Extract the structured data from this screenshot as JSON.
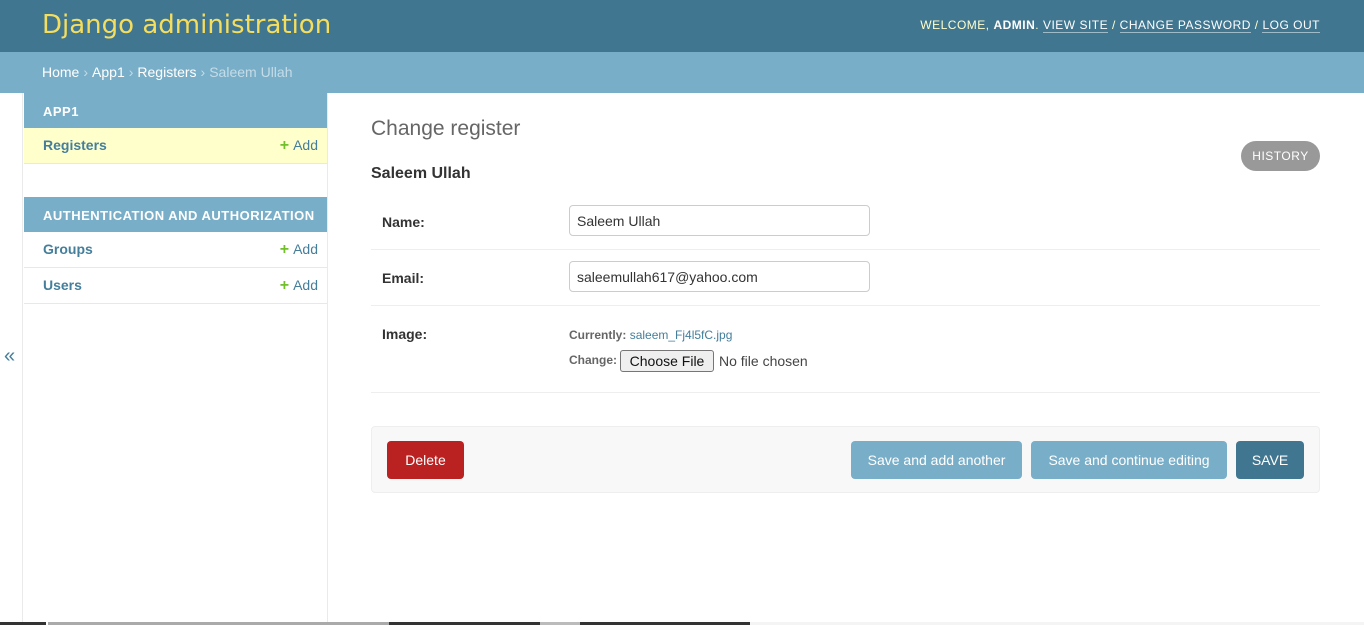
{
  "header": {
    "brand": "Django administration",
    "welcome_prefix": "WELCOME, ",
    "username": "ADMIN",
    "welcome_suffix": ". ",
    "view_site": "VIEW SITE",
    "change_password": "CHANGE PASSWORD",
    "log_out": "LOG OUT",
    "separator": " / "
  },
  "breadcrumbs": {
    "items": [
      "Home",
      "App1",
      "Registers"
    ],
    "current": "Saleem Ullah",
    "separator": "›"
  },
  "nav_toggle": "«",
  "sidebar": {
    "modules": [
      {
        "caption": "APP1",
        "rows": [
          {
            "label": "Registers",
            "add": "Add",
            "current": true
          }
        ]
      },
      {
        "caption": "AUTHENTICATION AND AUTHORIZATION",
        "rows": [
          {
            "label": "Groups",
            "add": "Add"
          },
          {
            "label": "Users",
            "add": "Add"
          }
        ]
      }
    ],
    "add_icon": "+"
  },
  "content": {
    "title": "Change register",
    "object_name": "Saleem Ullah",
    "history": "HISTORY",
    "fields": {
      "name_label": "Name:",
      "name_value": "Saleem Ullah",
      "email_label": "Email:",
      "email_value": "saleemullah617@yahoo.com",
      "image_label": "Image:",
      "currently_label": "Currently:",
      "currently_file": "saleem_Fj4l5fC.jpg",
      "change_label": "Change:",
      "choose_file": "Choose File",
      "no_file": "No file chosen"
    },
    "buttons": {
      "delete": "Delete",
      "save_add_another": "Save and add another",
      "save_continue": "Save and continue editing",
      "save": "SAVE"
    }
  },
  "colors": {
    "header_bg": "#417690",
    "brand": "#f5dd5d",
    "breadcrumb_bg": "#79aec8",
    "delete": "#ba2121",
    "add_plus": "#70bf2b",
    "link": "#447e9b"
  }
}
